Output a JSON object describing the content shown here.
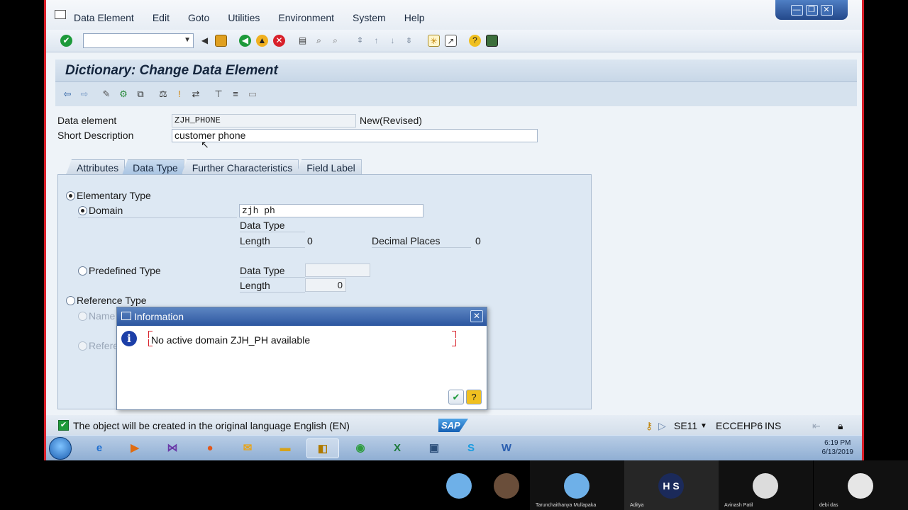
{
  "menu": {
    "items": [
      "Data Element",
      "Edit",
      "Goto",
      "Utilities",
      "Environment",
      "System",
      "Help"
    ]
  },
  "window_controls": {
    "minimize": "—",
    "restore": "❐",
    "close": "✕"
  },
  "header": {
    "title": "Dictionary: Change Data Element"
  },
  "form": {
    "data_element_label": "Data element",
    "data_element_value": "ZJH_PHONE",
    "data_element_status": "New(Revised)",
    "short_desc_label": "Short Description",
    "short_desc_value": "customer phone"
  },
  "tabs": [
    {
      "label": "Attributes"
    },
    {
      "label": "Data Type"
    },
    {
      "label": "Further Characteristics"
    },
    {
      "label": "Field Label"
    }
  ],
  "panel": {
    "elementary_type": "Elementary Type",
    "domain_label": "Domain",
    "domain_value": "zjh ph",
    "data_type_label": "Data Type",
    "length_label": "Length",
    "length_value": "0",
    "decimal_places_label": "Decimal Places",
    "decimal_places_value": "0",
    "predefined_type": "Predefined Type",
    "pre_data_type_label": "Data Type",
    "pre_length_label": "Length",
    "pre_length_value": "0",
    "reference_type": "Reference Type",
    "name_partial": "Name o",
    "reference_partial": "Referen"
  },
  "popup": {
    "title": "Information",
    "message": "No active domain ZJH_PH available"
  },
  "status": {
    "message": "The object will be created in the original language English (EN)",
    "sap_logo": "SAP",
    "transaction": "SE11",
    "system": "ECCEHP6",
    "mode": "INS"
  },
  "taskbar": {
    "time": "6:19 PM",
    "date": "6/13/2019"
  },
  "participants": [
    {
      "name": ""
    },
    {
      "name": ""
    },
    {
      "name": "Tarunchaithanya Mullapaka"
    },
    {
      "name": "Aditya"
    },
    {
      "name": "Avinash Patil"
    },
    {
      "name": "debi das"
    }
  ],
  "colors": {
    "accent_red": "#d8202a",
    "sap_blue": "#2c56a0",
    "status_green": "#1d9a3a"
  }
}
